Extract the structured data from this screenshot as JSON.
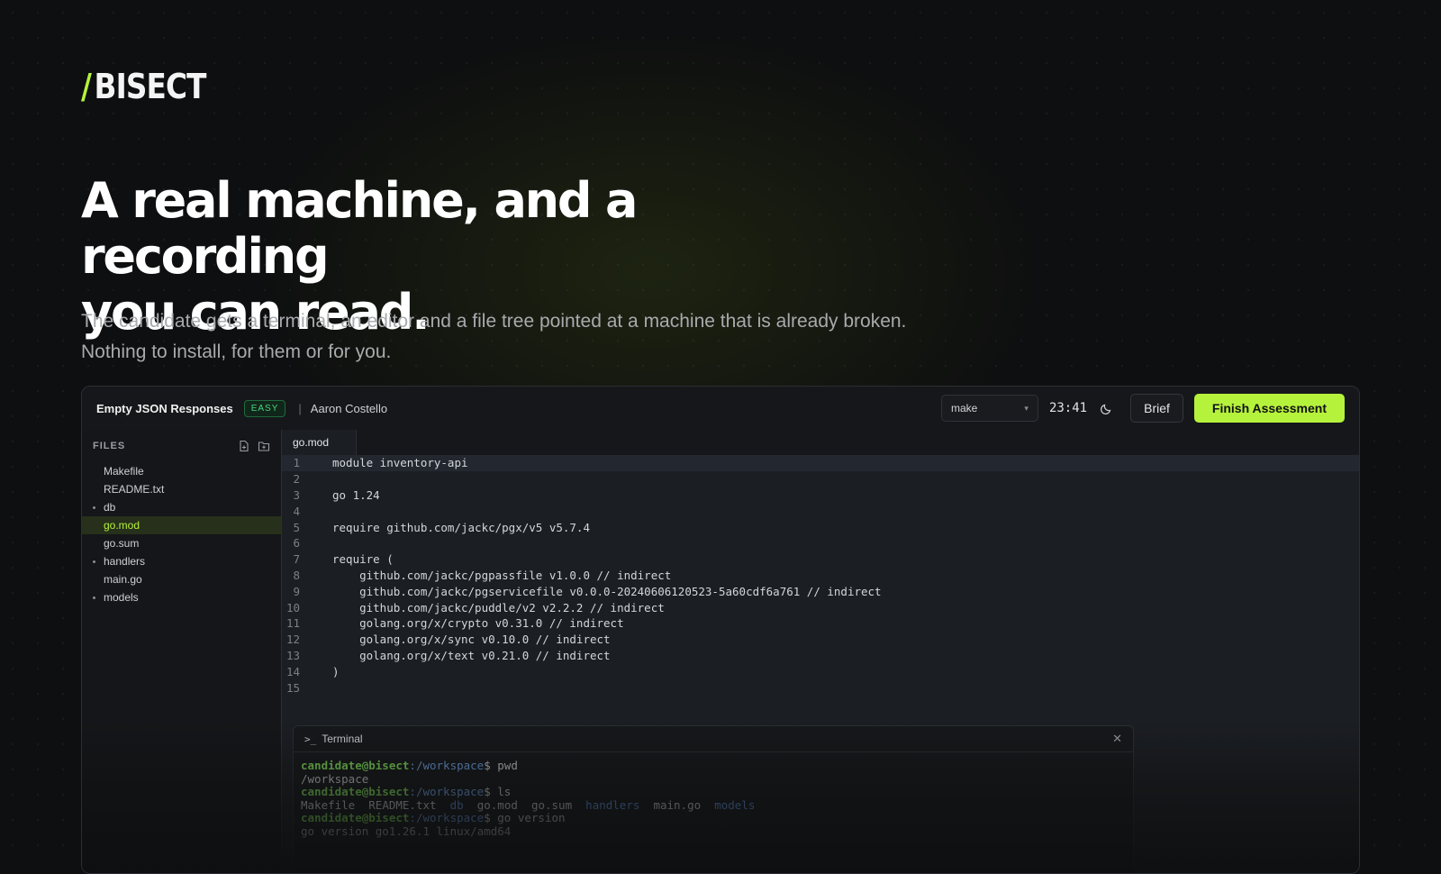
{
  "brand": {
    "slash": "/",
    "name": "BISECT",
    "accent": "#b5f23c"
  },
  "hero": {
    "title_line1": "A real machine, and a recording",
    "title_line2": "you can read.",
    "subtitle": "The candidate gets a terminal, an editor and a file tree pointed at a machine that is already broken. Nothing to install, for them or for you."
  },
  "app": {
    "task_title": "Empty JSON Responses",
    "difficulty": "EASY",
    "separator": "|",
    "candidate": "Aaron Costello",
    "command_select": "make",
    "timer": "23:41",
    "brief_label": "Brief",
    "finish_label": "Finish Assessment",
    "files_label": "FILES",
    "files": [
      {
        "name": "Makefile",
        "folder": false
      },
      {
        "name": "README.txt",
        "folder": false
      },
      {
        "name": "db",
        "folder": true
      },
      {
        "name": "go.mod",
        "folder": false,
        "active": true
      },
      {
        "name": "go.sum",
        "folder": false
      },
      {
        "name": "handlers",
        "folder": true
      },
      {
        "name": "main.go",
        "folder": false
      },
      {
        "name": "models",
        "folder": true
      }
    ],
    "open_tab": "go.mod",
    "code_lines": [
      "module inventory-api",
      "",
      "go 1.24",
      "",
      "require github.com/jackc/pgx/v5 v5.7.4",
      "",
      "require (",
      "    github.com/jackc/pgpassfile v1.0.0 // indirect",
      "    github.com/jackc/pgservicefile v0.0.0-20240606120523-5a60cdf6a761 // indirect",
      "    github.com/jackc/puddle/v2 v2.2.2 // indirect",
      "    golang.org/x/crypto v0.31.0 // indirect",
      "    golang.org/x/sync v0.10.0 // indirect",
      "    golang.org/x/text v0.21.0 // indirect",
      ")",
      ""
    ],
    "terminal": {
      "title": "Terminal",
      "prompt_user": "candidate@bisect",
      "prompt_path": ":/workspace",
      "prompt_symbol": "$ ",
      "cmd1": "pwd",
      "out1": "/workspace",
      "cmd2": "ls",
      "ls_items": [
        {
          "name": "Makefile",
          "dir": false
        },
        {
          "name": "README.txt",
          "dir": false
        },
        {
          "name": "db",
          "dir": true
        },
        {
          "name": "go.mod",
          "dir": false
        },
        {
          "name": "go.sum",
          "dir": false
        },
        {
          "name": "handlers",
          "dir": true
        },
        {
          "name": "main.go",
          "dir": false
        },
        {
          "name": "models",
          "dir": true
        }
      ],
      "cmd3": "go version",
      "out3": "go version go1.26.1 linux/amd64"
    }
  }
}
